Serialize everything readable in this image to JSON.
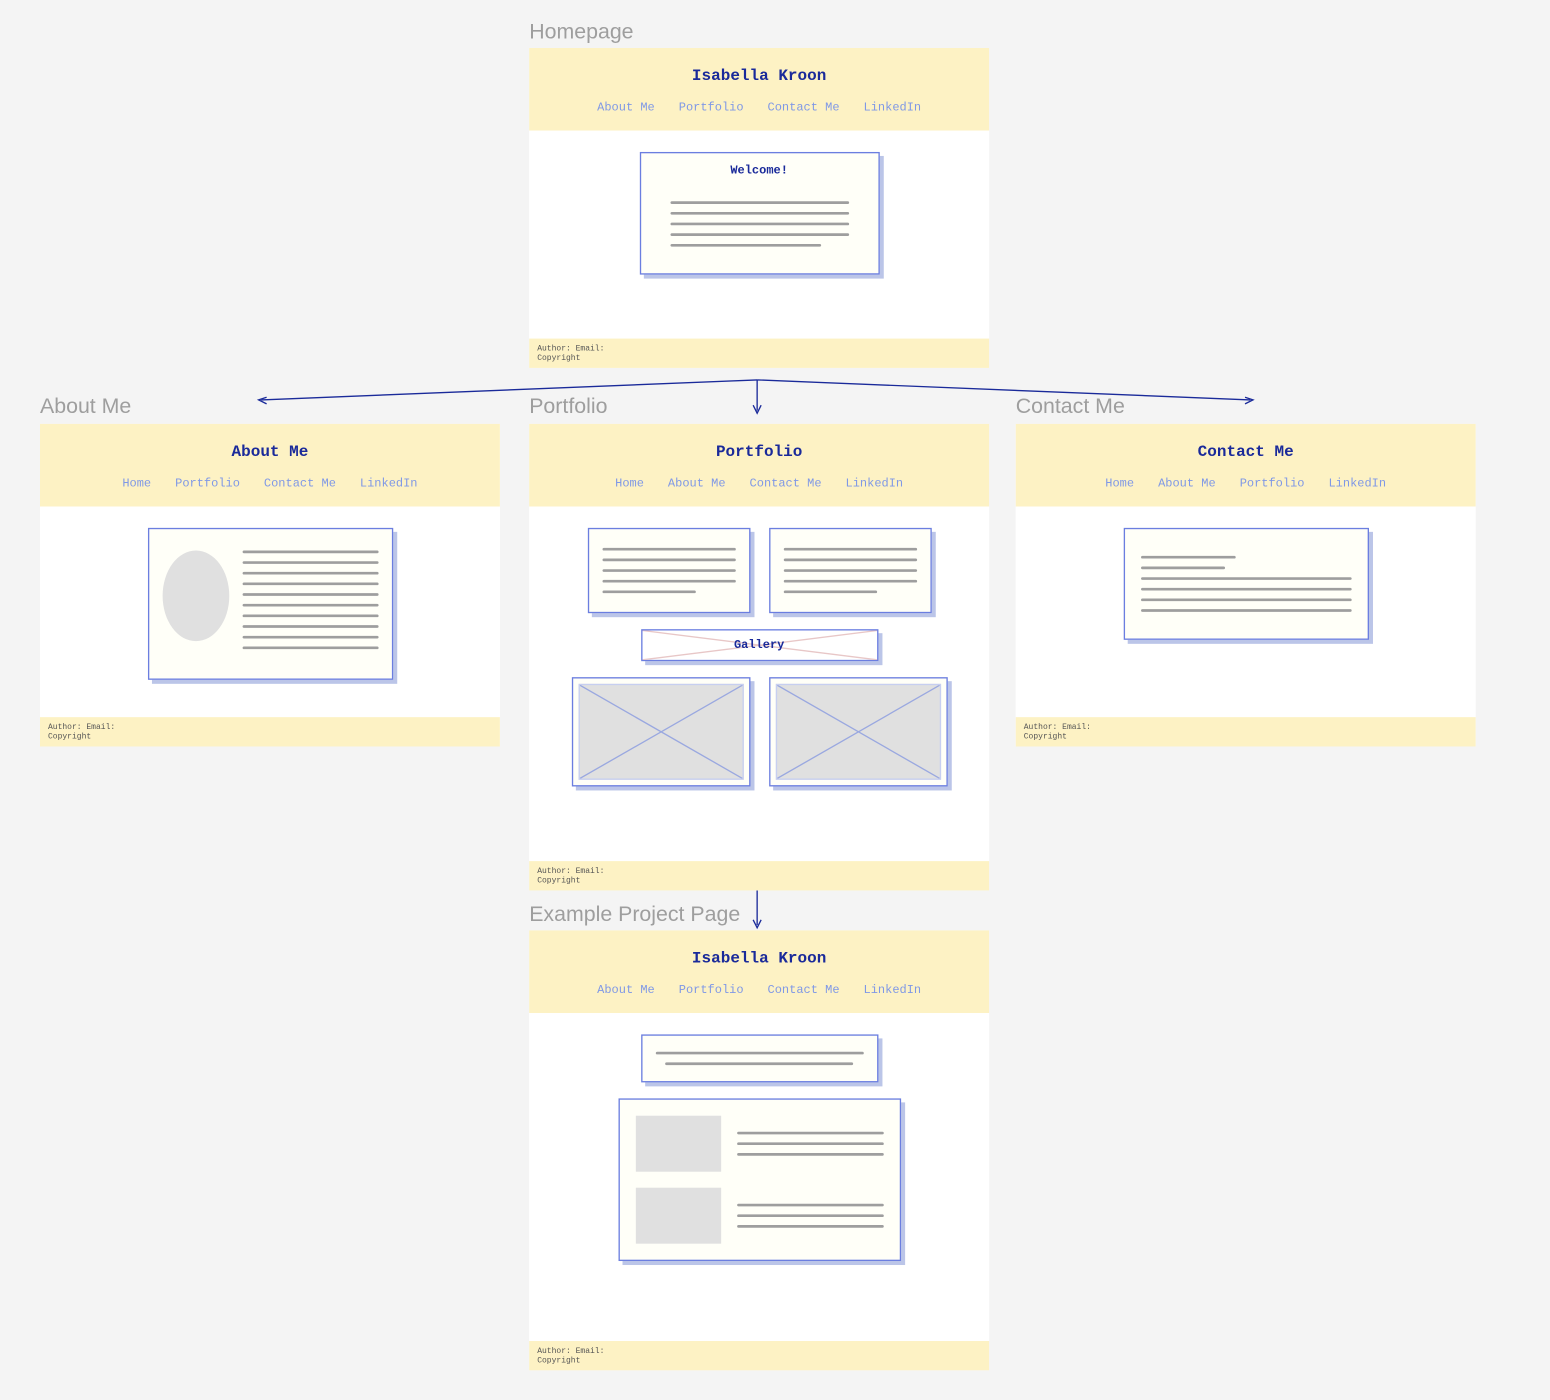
{
  "labels": {
    "homepage": "Homepage",
    "about": "About Me",
    "portfolio": "Portfolio",
    "contact": "Contact Me",
    "project": "Example Project Page"
  },
  "name": "Isabella Kroon",
  "nav": {
    "home": "Home",
    "about": "About Me",
    "portfolio": "Portfolio",
    "contact": "Contact Me",
    "linkedin": "LinkedIn"
  },
  "headers": {
    "about_title": "About Me",
    "portfolio_title": "Portfolio",
    "contact_title": "Contact Me"
  },
  "content": {
    "welcome": "Welcome!",
    "gallery": "Gallery"
  },
  "footer": {
    "line1": "Author: Email:",
    "line2": "Copyright"
  }
}
